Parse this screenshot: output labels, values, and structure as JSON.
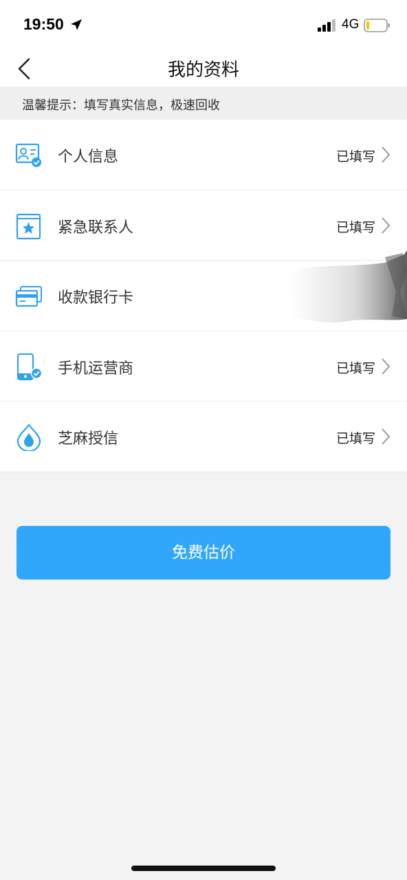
{
  "status_bar": {
    "time": "19:50",
    "network": "4G",
    "icons": [
      "location-arrow-icon",
      "signal-icon",
      "battery-icon"
    ]
  },
  "nav": {
    "title": "我的资料",
    "back_icon": "chevron-left-icon"
  },
  "notice": {
    "text": "温馨提示：填写真实信息，极速回收"
  },
  "items": [
    {
      "label": "个人信息",
      "status": "已填写",
      "icon": "id-card-check-icon"
    },
    {
      "label": "紧急联系人",
      "status": "已填写",
      "icon": "contact-book-star-icon"
    },
    {
      "label": "收款银行卡",
      "status": "",
      "icon": "bank-card-icon"
    },
    {
      "label": "手机运营商",
      "status": "已填写",
      "icon": "phone-check-icon"
    },
    {
      "label": "芝麻授信",
      "status": "已填写",
      "icon": "sesame-drop-icon"
    }
  ],
  "button": {
    "label": "免费估价"
  },
  "colors": {
    "accent": "#31a7fb",
    "icon_blue": "#2fa2f0",
    "background": "#f3f3f3"
  }
}
